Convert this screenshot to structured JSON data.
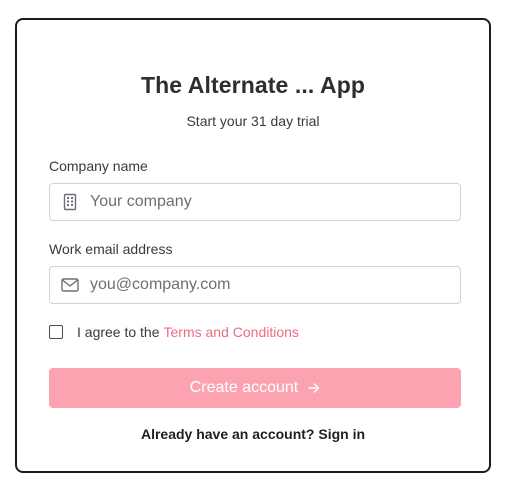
{
  "app": {
    "title": "The Alternate ... App",
    "subtitle": "Start your 31 day trial"
  },
  "form": {
    "company": {
      "label": "Company name",
      "placeholder": "Your company",
      "value": "",
      "icon": "building-icon"
    },
    "email": {
      "label": "Work email address",
      "placeholder": "you@company.com",
      "value": "",
      "icon": "envelope-icon"
    },
    "agree": {
      "checked": false,
      "text": "I agree to the",
      "link_text": "Terms and Conditions"
    },
    "submit": {
      "label": "Create account",
      "icon": "arrow-right-icon",
      "disabled": true
    },
    "signin_text": "Already have an account? Sign in"
  },
  "colors": {
    "accent": "#ec6b86",
    "button_disabled_bg": "#fba3b1",
    "border": "#1c1c1c",
    "input_border": "#cfd3d8"
  }
}
